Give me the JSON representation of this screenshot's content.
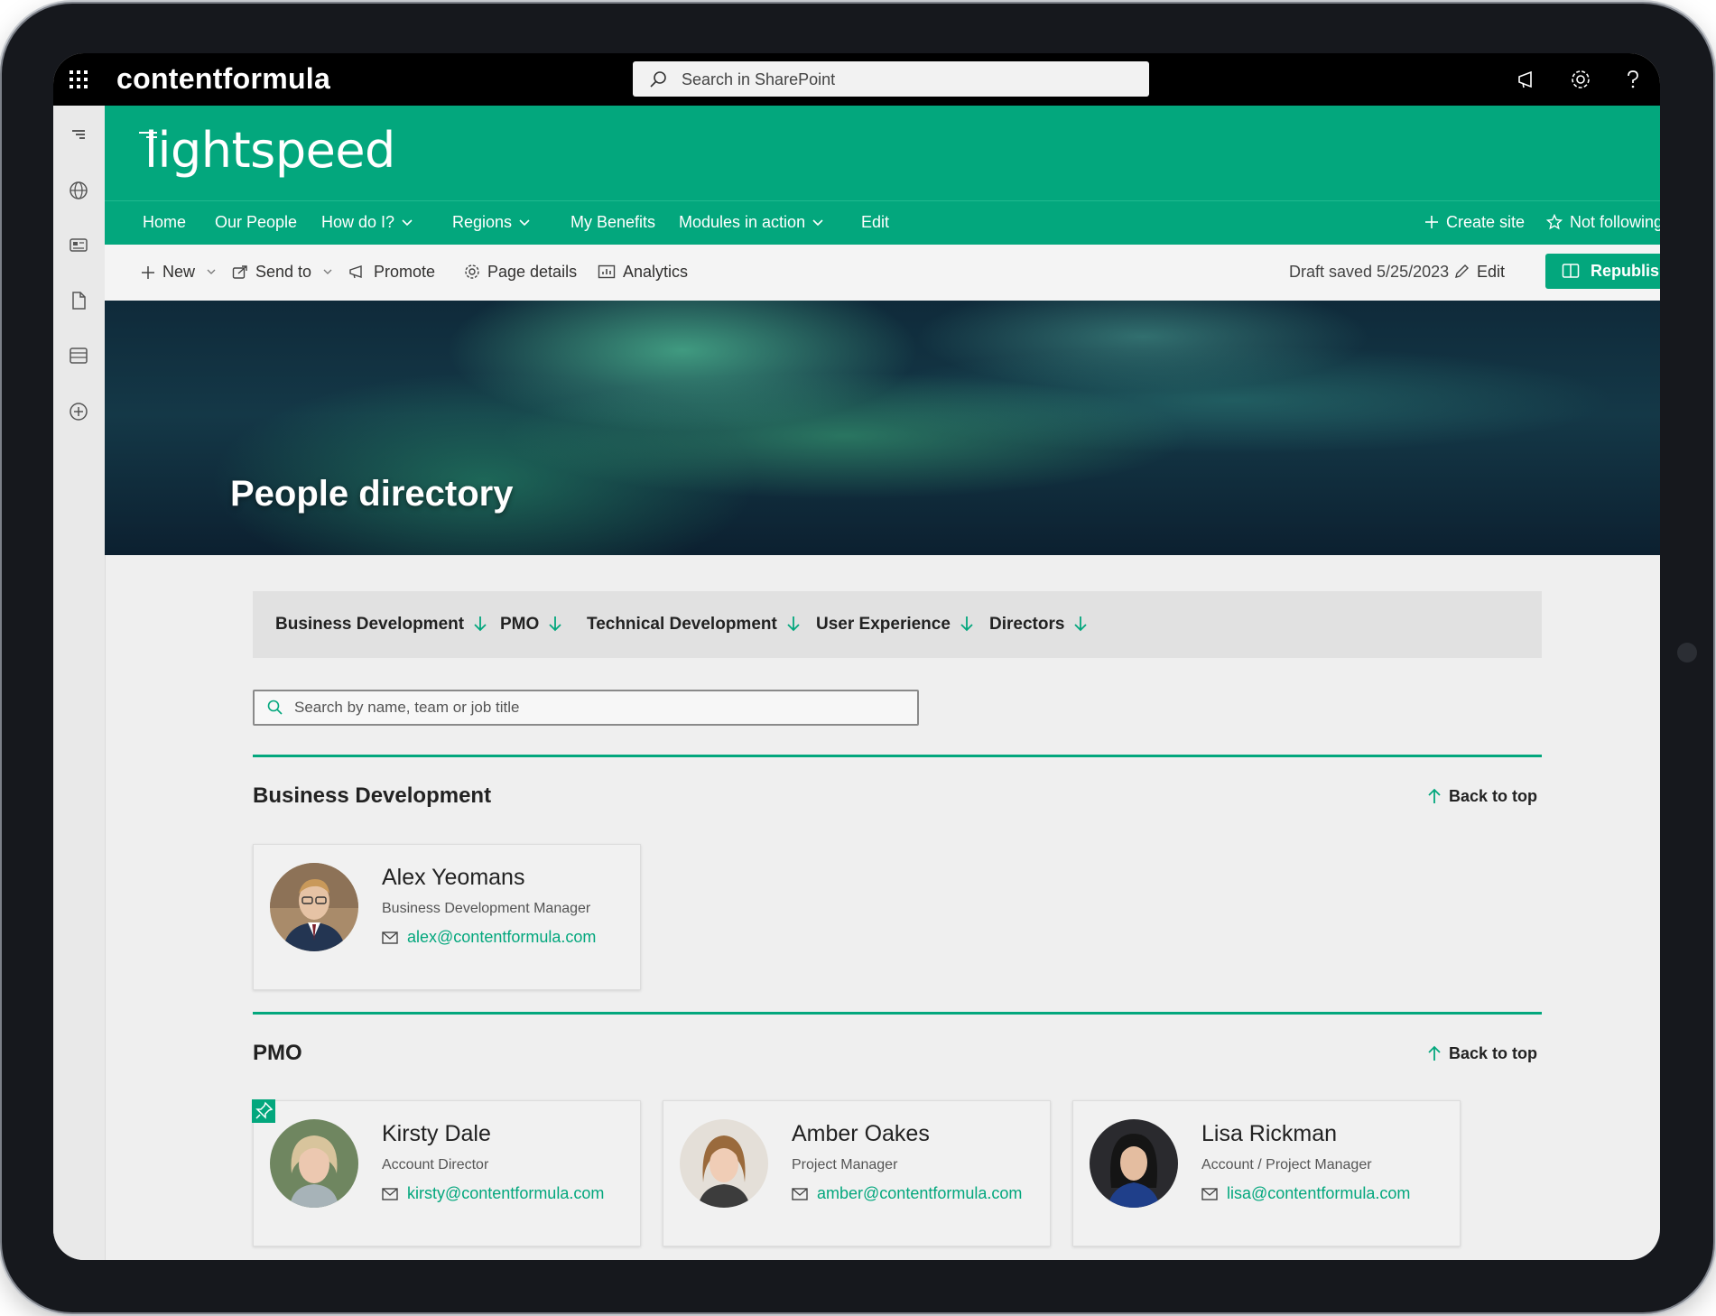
{
  "suite_bar": {
    "brand": "contentformula",
    "search_placeholder": "Search in SharePoint"
  },
  "site": {
    "logo_text": "lightspeed"
  },
  "nav": {
    "items": [
      {
        "label": "Home",
        "has_dropdown": false
      },
      {
        "label": "Our People",
        "has_dropdown": false
      },
      {
        "label": "How do I?",
        "has_dropdown": true
      },
      {
        "label": "Regions",
        "has_dropdown": true
      },
      {
        "label": "My Benefits",
        "has_dropdown": false
      },
      {
        "label": "Modules in action",
        "has_dropdown": true
      },
      {
        "label": "Edit",
        "has_dropdown": false
      }
    ],
    "create_site": "Create site",
    "not_following": "Not following"
  },
  "command_bar": {
    "new": "New",
    "send_to": "Send to",
    "promote": "Promote",
    "page_details": "Page details",
    "analytics": "Analytics",
    "draft_status": "Draft saved 5/25/2023",
    "edit": "Edit",
    "republish": "Republish"
  },
  "hero": {
    "title": "People directory"
  },
  "filters": {
    "tabs": [
      "Business Development",
      "PMO",
      "Technical Development",
      "User Experience",
      "Directors"
    ]
  },
  "people_search": {
    "placeholder": "Search by name, team or job title"
  },
  "sections": [
    {
      "title": "Business Development",
      "back_to_top": "Back to top",
      "people": [
        {
          "name": "Alex Yeomans",
          "title": "Business Development Manager",
          "email": "alex@contentformula.com"
        }
      ]
    },
    {
      "title": "PMO",
      "back_to_top": "Back to top",
      "people": [
        {
          "name": "Kirsty Dale",
          "title": "Account Director",
          "email": "kirsty@contentformula.com",
          "pinned": true
        },
        {
          "name": "Amber Oakes",
          "title": "Project Manager",
          "email": "amber@contentformula.com"
        },
        {
          "name": "Lisa Rickman",
          "title": "Account / Project Manager",
          "email": "lisa@contentformula.com"
        }
      ]
    }
  ],
  "colors": {
    "brand_green": "#03a77d",
    "suite_bar": "#000000",
    "page_bg": "#efefef"
  },
  "icons": [
    "waffle-icon",
    "search-icon",
    "megaphone-icon",
    "gear-icon",
    "help-icon",
    "globe-icon",
    "news-icon",
    "document-icon",
    "list-icon",
    "add-circle-icon",
    "plus-icon",
    "star-icon",
    "share-icon",
    "promote-icon",
    "settings-icon",
    "analytics-icon",
    "pencil-icon",
    "book-icon",
    "arrow-down-icon",
    "arrow-up-icon",
    "mail-icon",
    "pin-icon"
  ]
}
